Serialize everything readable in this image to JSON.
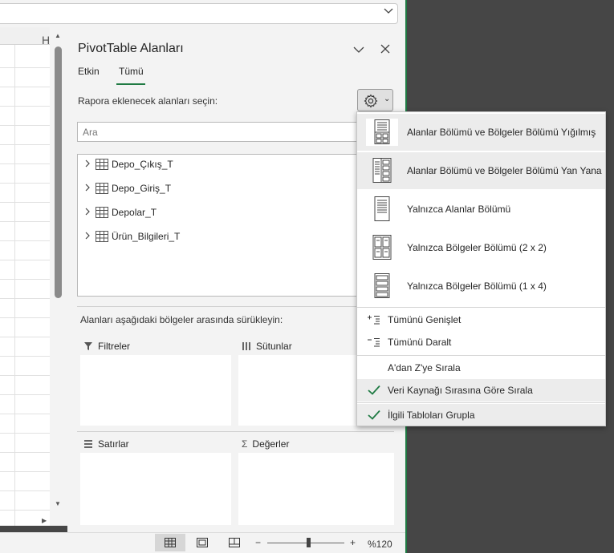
{
  "pane": {
    "title": "PivotTable Alanları",
    "tabs": [
      {
        "label": "Etkin"
      },
      {
        "label": "Tümü"
      }
    ],
    "instruction": "Rapora eklenecek alanları seçin:",
    "search_placeholder": "Ara",
    "fields": [
      {
        "label": "Depo_Çıkış_T"
      },
      {
        "label": "Depo_Giriş_T"
      },
      {
        "label": "Depolar_T"
      },
      {
        "label": "Ürün_Bilgileri_T"
      }
    ],
    "drag_instruction": "Alanları aşağıdaki bölgeler arasında sürükleyin:",
    "areas": {
      "filters": "Filtreler",
      "columns": "Sütunlar",
      "rows": "Satırlar",
      "values": "Değerler"
    }
  },
  "sheet": {
    "column_letter": "H"
  },
  "menu": {
    "layout_items": [
      {
        "label": "Alanlar Bölümü ve Bölgeler Bölümü Yığılmış",
        "icon": "stacked-layout-icon"
      },
      {
        "label": "Alanlar Bölümü ve Bölgeler Bölümü Yan Yana",
        "icon": "side-by-side-layout-icon"
      },
      {
        "label": "Yalnızca Alanlar Bölümü",
        "icon": "fields-only-icon"
      },
      {
        "label": "Yalnızca Bölgeler Bölümü (2 x 2)",
        "icon": "areas-2x2-icon"
      },
      {
        "label": "Yalnızca Bölgeler Bölümü (1 x 4)",
        "icon": "areas-1x4-icon"
      }
    ],
    "expand_all": "Tümünü Genişlet",
    "collapse_all": "Tümünü Daralt",
    "sort_az": "A'dan Z'ye Sırala",
    "sort_source": "Veri Kaynağı Sırasına Göre Sırala",
    "group_tables": "İlgili Tabloları Grupla"
  },
  "status": {
    "zoom": "%120"
  },
  "colors": {
    "accent": "#1f7a43",
    "check": "#1f7a43"
  }
}
